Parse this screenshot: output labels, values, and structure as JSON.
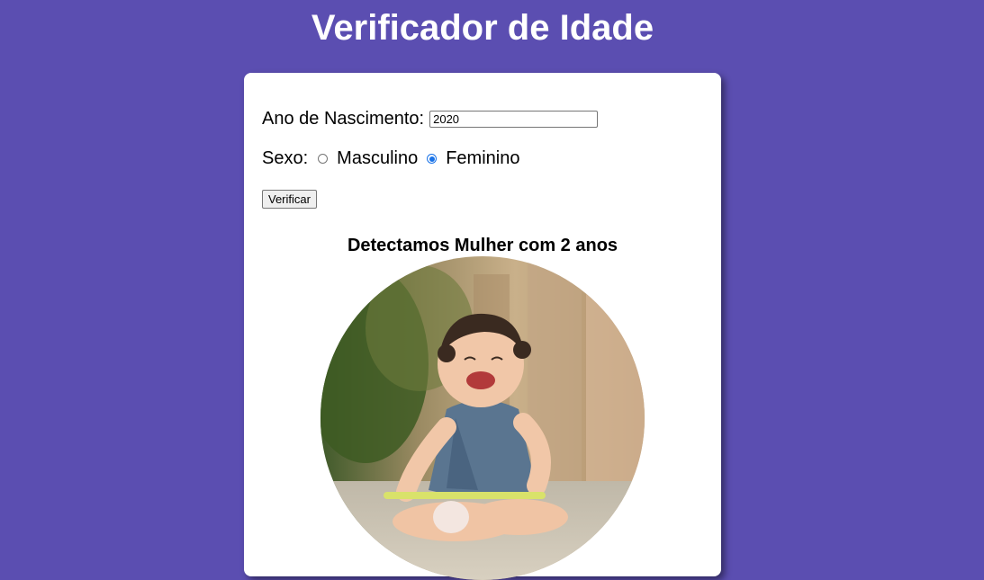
{
  "header": {
    "title": "Verificador de Idade"
  },
  "form": {
    "year_label": "Ano de Nascimento:",
    "year_value": "2020",
    "sex_label": "Sexo:",
    "options": [
      {
        "label": "Masculino",
        "checked": false
      },
      {
        "label": "Feminino",
        "checked": true
      }
    ],
    "verify_label": "Verificar"
  },
  "result": {
    "text": "Detectamos Mulher com 2 anos",
    "image_icon": "baby-girl-photo"
  },
  "colors": {
    "background": "#5b4eb1",
    "card": "#ffffff",
    "accent": "#1a73e8"
  }
}
